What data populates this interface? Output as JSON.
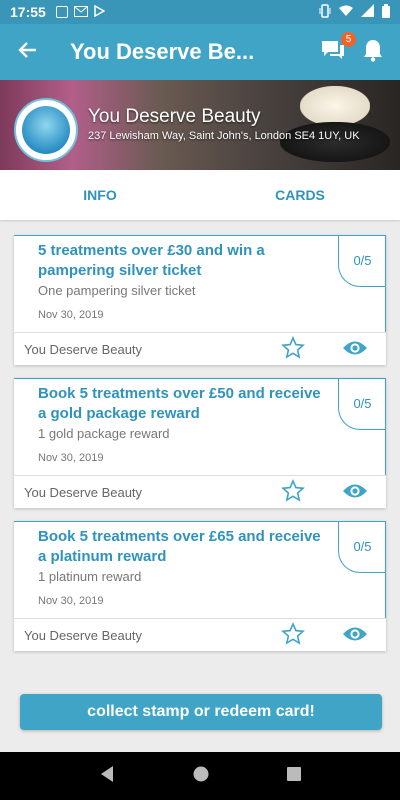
{
  "status_bar": {
    "time": "17:55"
  },
  "app_bar": {
    "back_icon": "arrow-left-icon",
    "title": "You Deserve Be...",
    "chat_badge": "5",
    "colors": {
      "primary": "#3fa4c6",
      "status": "#3a96b8"
    }
  },
  "banner": {
    "name": "You Deserve Beauty",
    "address": "237 Lewisham Way, Saint John's, London SE4 1UY, UK"
  },
  "tabs": [
    "INFO",
    "CARDS"
  ],
  "cards": [
    {
      "title": "5 treatments over £30 and win a pampering silver ticket",
      "reward": "One pampering silver ticket",
      "date": "Nov 30, 2019",
      "progress": "0/5",
      "merchant": "You Deserve Beauty"
    },
    {
      "title": "Book 5 treatments over £50 and receive a gold package reward",
      "reward": "1 gold package reward",
      "date": "Nov 30, 2019",
      "progress": "0/5",
      "merchant": "You Deserve Beauty"
    },
    {
      "title": "Book 5 treatments over £65 and receive a platinum reward",
      "reward": "1 platinum reward",
      "date": "Nov 30, 2019",
      "progress": "0/5",
      "merchant": "You Deserve Beauty"
    }
  ],
  "cta": {
    "label": "collect stamp or redeem card!"
  }
}
